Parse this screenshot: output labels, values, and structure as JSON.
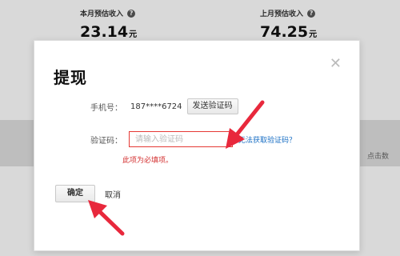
{
  "background": {
    "this_month": {
      "label": "本月预估收入",
      "value": "23.14",
      "unit": "元"
    },
    "last_month": {
      "label": "上月预估收入",
      "value": "74.25",
      "unit": "元"
    },
    "help_icon": "question-circle-icon",
    "clicks_label": "点击数"
  },
  "dialog": {
    "title": "提现",
    "close_icon": "close-icon",
    "phone_label": "手机号：",
    "phone_value": "187****6724",
    "send_code_label": "发送验证码",
    "code_label": "验证码：",
    "code_placeholder": "请输入验证码",
    "code_value": "",
    "cant_get_code_link": "无法获取验证码？",
    "error_message": "此项为必填项。",
    "confirm_label": "确定",
    "cancel_label": "取消"
  },
  "colors": {
    "error": "#d32f2f",
    "link": "#1a6fc4",
    "annotation_arrow": "#e8283c"
  }
}
